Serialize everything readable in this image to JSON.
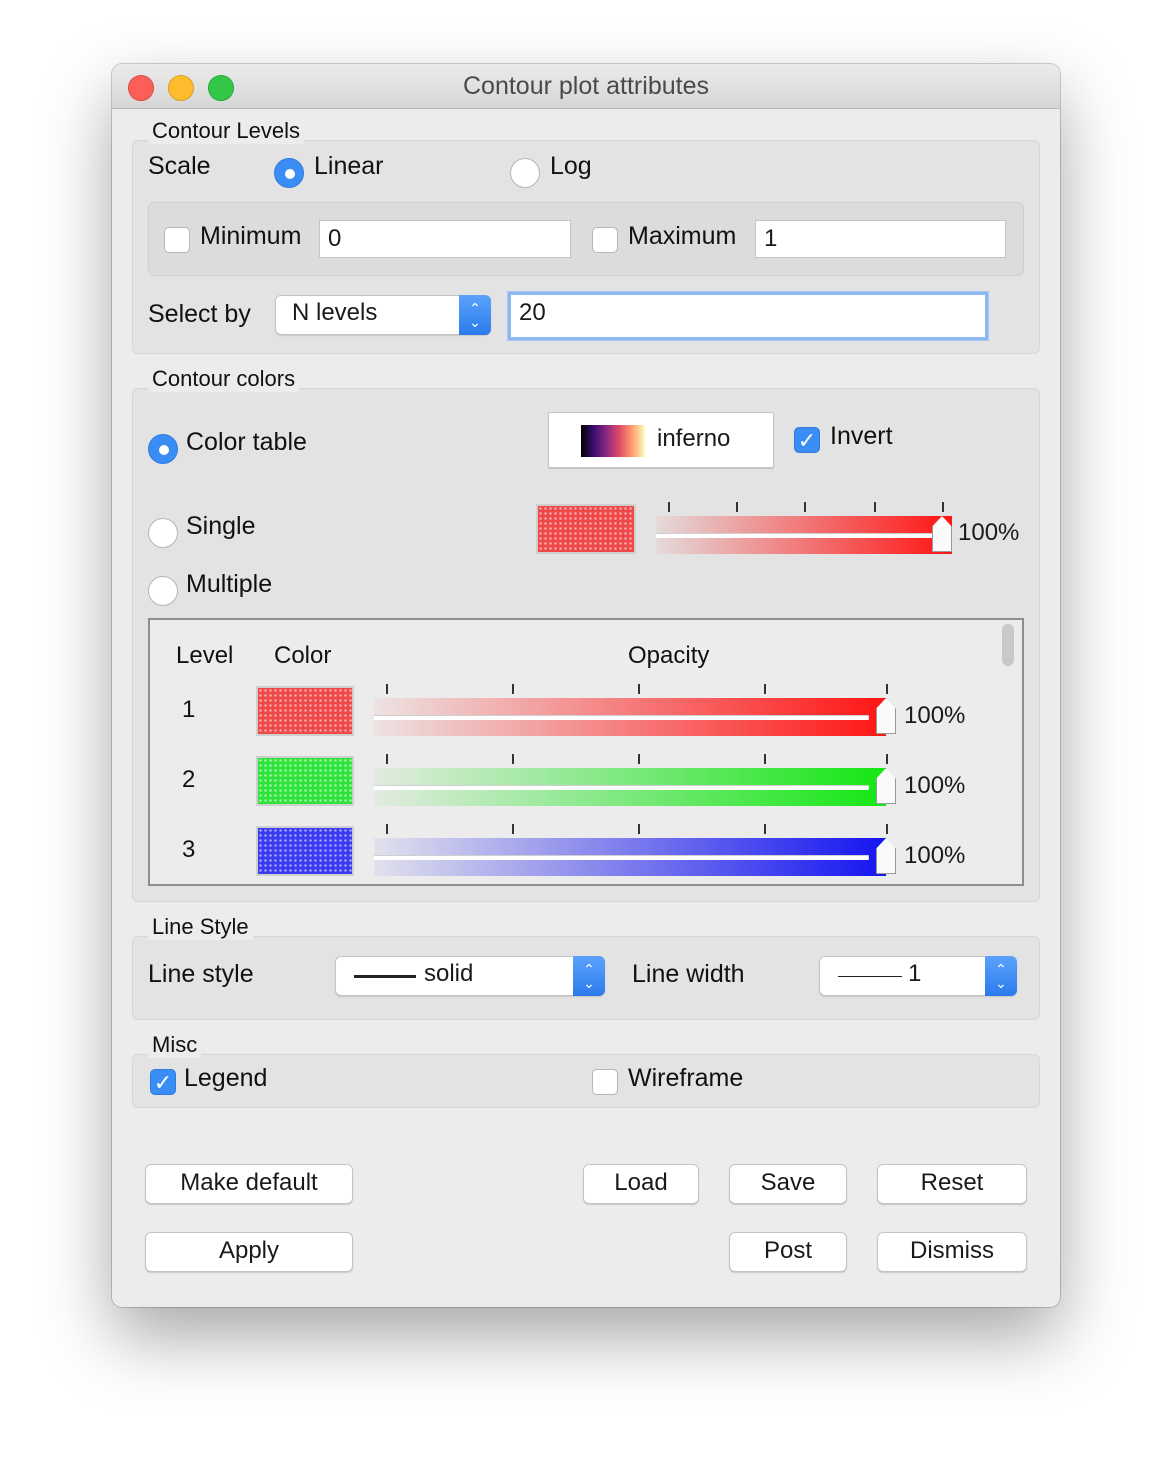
{
  "window": {
    "title": "Contour plot attributes"
  },
  "contour_levels": {
    "group_label": "Contour Levels",
    "scale_label": "Scale",
    "scale_options": {
      "linear": "Linear",
      "log": "Log",
      "selected": "Linear"
    },
    "minimum": {
      "label": "Minimum",
      "value": "0",
      "checked": false
    },
    "maximum": {
      "label": "Maximum",
      "value": "1",
      "checked": false
    },
    "select_by_label": "Select by",
    "select_by_value": "N levels",
    "levels_value": "20"
  },
  "contour_colors": {
    "group_label": "Contour colors",
    "color_table": {
      "label": "Color table",
      "selected": true,
      "table_name": "inferno",
      "invert_label": "Invert",
      "invert_checked": true
    },
    "single": {
      "label": "Single",
      "selected": false,
      "color": "#f04848",
      "opacity": 100,
      "opacity_text": "100%"
    },
    "multiple": {
      "label": "Multiple",
      "selected": false
    },
    "table": {
      "headers": {
        "level": "Level",
        "color": "Color",
        "opacity": "Opacity"
      },
      "rows": [
        {
          "level": "1",
          "color": "#ff2020",
          "opacity": 100,
          "opacity_text": "100%"
        },
        {
          "level": "2",
          "color": "#20e020",
          "opacity": 100,
          "opacity_text": "100%"
        },
        {
          "level": "3",
          "color": "#2020f0",
          "opacity": 100,
          "opacity_text": "100%"
        }
      ]
    }
  },
  "line_style": {
    "group_label": "Line Style",
    "line_style_label": "Line style",
    "line_style_value": "solid",
    "line_width_label": "Line width",
    "line_width_value": "1"
  },
  "misc": {
    "group_label": "Misc",
    "legend_label": "Legend",
    "legend_checked": true,
    "wireframe_label": "Wireframe",
    "wireframe_checked": false
  },
  "buttons": {
    "make_default": "Make default",
    "load": "Load",
    "save": "Save",
    "reset": "Reset",
    "apply": "Apply",
    "post": "Post",
    "dismiss": "Dismiss"
  },
  "icons": {
    "checkmark": "✓",
    "combo_arrows": "updown-chevron-icon",
    "colormap": "inferno-gradient-icon"
  }
}
